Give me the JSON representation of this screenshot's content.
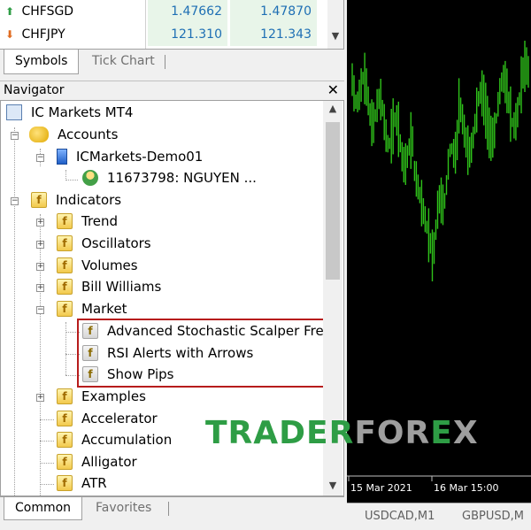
{
  "market_watch": {
    "rows": [
      {
        "symbol": "CHFSGD",
        "bid": "1.47662",
        "ask": "1.47870",
        "direction": "up",
        "color": "#2e9d45"
      },
      {
        "symbol": "CHFJPY",
        "bid": "121.310",
        "ask": "121.343",
        "direction": "down",
        "color": "#e06b20"
      }
    ],
    "tabs": {
      "symbols": "Symbols",
      "tick_chart": "Tick Chart"
    }
  },
  "navigator": {
    "title": "Navigator",
    "close": "✕",
    "root": "IC Markets MT4",
    "accounts": "Accounts",
    "server": "ICMarkets-Demo01",
    "account_name": "11673798: NGUYEN ...",
    "indicators": "Indicators",
    "groups": [
      "Trend",
      "Oscillators",
      "Volumes",
      "Bill Williams",
      "Market"
    ],
    "market_children": [
      "Advanced Stochastic Scalper Free",
      "RSI Alerts with Arrows",
      "Show Pips"
    ],
    "more": [
      "Examples",
      "Accelerator",
      "Accumulation",
      "Alligator",
      "ATR"
    ],
    "tabs": {
      "common": "Common",
      "favorites": "Favorites"
    }
  },
  "chart": {
    "x_labels": [
      "15 Mar 2021",
      "16 Mar 15:00"
    ],
    "bar_color": "#2fc21a",
    "tabs": [
      "USDCAD,M1",
      "GBPUSD,M"
    ]
  },
  "watermark": {
    "part1": "TRADER",
    "part2": "FOR",
    "part3": "E",
    "part4": "X"
  }
}
